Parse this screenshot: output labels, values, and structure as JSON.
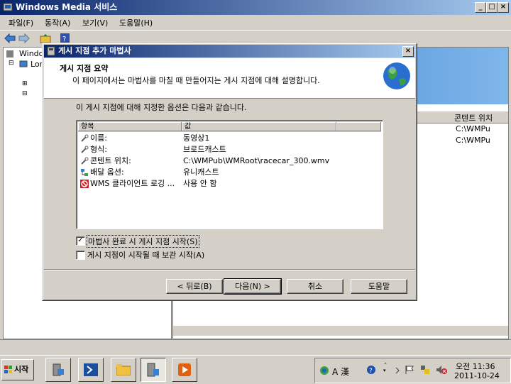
{
  "app": {
    "title": "Windows Media 서비스",
    "menu": [
      "파일(F)",
      "동작(A)",
      "보기(V)",
      "도움말(H)"
    ],
    "tree": [
      "Windo",
      "Lor"
    ],
    "right_columns": [
      "콘텐트 위치"
    ],
    "right_rows": [
      "C:\\WMPu",
      "C:\\WMPu"
    ]
  },
  "dialog": {
    "title": "게시 지점 추가 마법사",
    "heading": "게시 지점 요약",
    "subheading": "이 페이지에서는 마법사를 마칠 때 만들어지는 게시 지점에 대해 설명합니다.",
    "intro": "이 게시 지점에 대해 지정한 옵션은 다음과 같습니다.",
    "columns": [
      "항목",
      "값"
    ],
    "rows": [
      {
        "key": "이름:",
        "value": "동영상1",
        "icon": "wrench-icon"
      },
      {
        "key": "형식:",
        "value": "브로드캐스트",
        "icon": "wrench-icon"
      },
      {
        "key": "콘텐트 위치:",
        "value": "C:\\WMPub\\WMRoot\\racecar_300.wmv",
        "icon": "wrench-icon"
      },
      {
        "key": "배달 옵션:",
        "value": "유니캐스트",
        "icon": "network-icon"
      },
      {
        "key": "WMS 클라이언트 로깅 ...",
        "value": "사용 안 함",
        "icon": "disabled-icon"
      }
    ],
    "checkbox1": {
      "label": "마법사 완료 시 게시 지점 시작(S)",
      "checked": true
    },
    "checkbox2": {
      "label": "게시 지점이 시작될 때 보관 시작(A)",
      "checked": false
    },
    "buttons": {
      "back": "< 뒤로(B)",
      "next": "다음(N) >",
      "cancel": "취소",
      "help": "도움말"
    }
  },
  "taskbar": {
    "start": "시작",
    "ime": "A 漢",
    "time": "오전 11:36",
    "date": "2011-10-24"
  },
  "colors": {
    "titlebar": "#0a246a",
    "titlebar_end": "#a6caf0",
    "face": "#d4d0c8"
  }
}
